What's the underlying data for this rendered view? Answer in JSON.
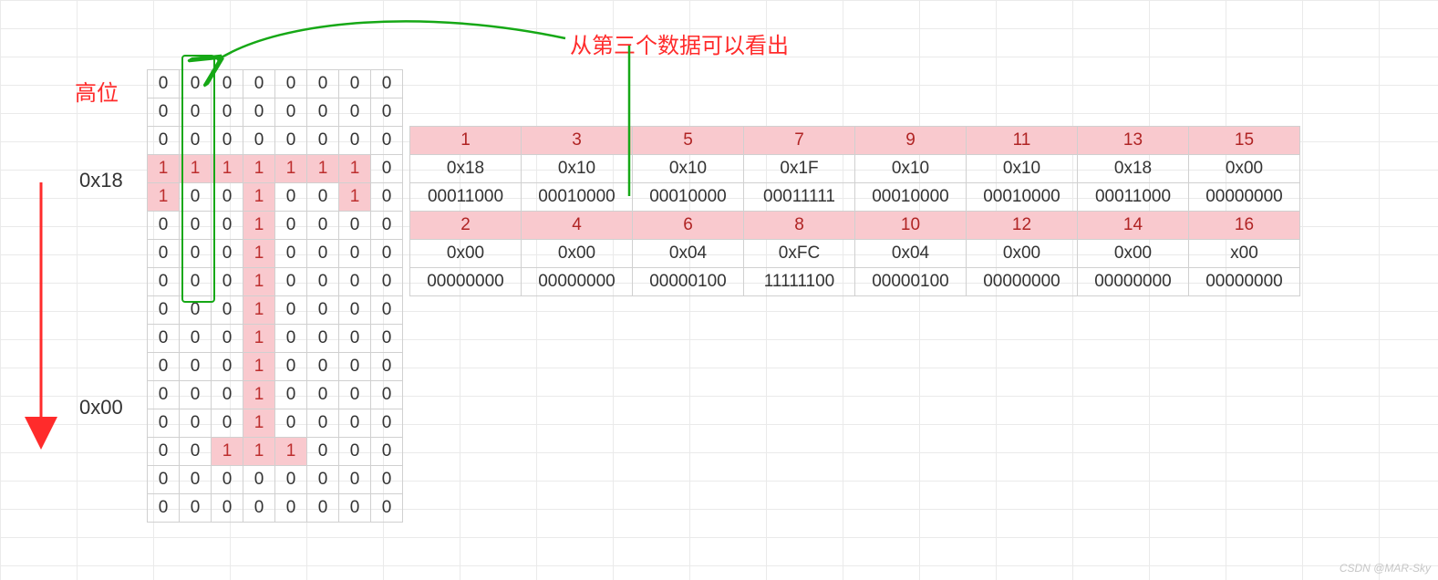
{
  "annotations": {
    "top_title": "从第三个数据可以看出",
    "high_bit": "高位",
    "label_0x18": "0x18",
    "label_0x00": "0x00"
  },
  "bit_matrix_16x8": [
    [
      "0",
      "0",
      "0",
      "0",
      "0",
      "0",
      "0",
      "0"
    ],
    [
      "0",
      "0",
      "0",
      "0",
      "0",
      "0",
      "0",
      "0"
    ],
    [
      "0",
      "0",
      "0",
      "0",
      "0",
      "0",
      "0",
      "0"
    ],
    [
      "1",
      "1",
      "1",
      "1",
      "1",
      "1",
      "1",
      "0"
    ],
    [
      "1",
      "0",
      "0",
      "1",
      "0",
      "0",
      "1",
      "0"
    ],
    [
      "0",
      "0",
      "0",
      "1",
      "0",
      "0",
      "0",
      "0"
    ],
    [
      "0",
      "0",
      "0",
      "1",
      "0",
      "0",
      "0",
      "0"
    ],
    [
      "0",
      "0",
      "0",
      "1",
      "0",
      "0",
      "0",
      "0"
    ],
    [
      "0",
      "0",
      "0",
      "1",
      "0",
      "0",
      "0",
      "0"
    ],
    [
      "0",
      "0",
      "0",
      "1",
      "0",
      "0",
      "0",
      "0"
    ],
    [
      "0",
      "0",
      "0",
      "1",
      "0",
      "0",
      "0",
      "0"
    ],
    [
      "0",
      "0",
      "0",
      "1",
      "0",
      "0",
      "0",
      "0"
    ],
    [
      "0",
      "0",
      "0",
      "1",
      "0",
      "0",
      "0",
      "0"
    ],
    [
      "0",
      "0",
      "1",
      "1",
      "1",
      "0",
      "0",
      "0"
    ],
    [
      "0",
      "0",
      "0",
      "0",
      "0",
      "0",
      "0",
      "0"
    ],
    [
      "0",
      "0",
      "0",
      "0",
      "0",
      "0",
      "0",
      "0"
    ]
  ],
  "bit_matrix_pink_mask": [
    [
      0,
      0,
      0,
      0,
      0,
      0,
      0,
      0
    ],
    [
      0,
      0,
      0,
      0,
      0,
      0,
      0,
      0
    ],
    [
      0,
      0,
      0,
      0,
      0,
      0,
      0,
      0
    ],
    [
      1,
      1,
      1,
      1,
      1,
      1,
      1,
      0
    ],
    [
      1,
      0,
      0,
      1,
      0,
      0,
      1,
      0
    ],
    [
      0,
      0,
      0,
      1,
      0,
      0,
      0,
      0
    ],
    [
      0,
      0,
      0,
      1,
      0,
      0,
      0,
      0
    ],
    [
      0,
      0,
      0,
      1,
      0,
      0,
      0,
      0
    ],
    [
      0,
      0,
      0,
      1,
      0,
      0,
      0,
      0
    ],
    [
      0,
      0,
      0,
      1,
      0,
      0,
      0,
      0
    ],
    [
      0,
      0,
      0,
      1,
      0,
      0,
      0,
      0
    ],
    [
      0,
      0,
      0,
      1,
      0,
      0,
      0,
      0
    ],
    [
      0,
      0,
      0,
      1,
      0,
      0,
      0,
      0
    ],
    [
      0,
      0,
      1,
      1,
      1,
      0,
      0,
      0
    ],
    [
      0,
      0,
      0,
      0,
      0,
      0,
      0,
      0
    ],
    [
      0,
      0,
      0,
      0,
      0,
      0,
      0,
      0
    ]
  ],
  "right": {
    "idx_odd": [
      "1",
      "3",
      "5",
      "7",
      "9",
      "11",
      "13",
      "15"
    ],
    "hex_odd": [
      "0x18",
      "0x10",
      "0x10",
      "0x1F",
      "0x10",
      "0x10",
      "0x18",
      "0x00"
    ],
    "bin_odd": [
      "00011000",
      "00010000",
      "00010000",
      "00011111",
      "00010000",
      "00010000",
      "00011000",
      "00000000"
    ],
    "idx_even": [
      "2",
      "4",
      "6",
      "8",
      "10",
      "12",
      "14",
      "16"
    ],
    "hex_even": [
      "0x00",
      "0x00",
      "0x04",
      "0xFC",
      "0x04",
      "0x00",
      "0x00",
      "x00"
    ],
    "bin_even": [
      "00000000",
      "00000000",
      "00000100",
      "11111100",
      "00000100",
      "00000000",
      "00000000",
      "00000000"
    ]
  },
  "watermark": "CSDN @MAR-Sky",
  "chart_data": {
    "type": "table",
    "description": "16x16 font bitmap for a Chinese glyph shown as a 16-row by 8-column (wide-byte) bit matrix on the left, and the corresponding 16 bytes (two rows of 8) in hex and binary on the right. Pink cells mark bits equal to 1. Green rectangle highlights column 2 (the high-bit column). Red downward arrow indicates scan direction.",
    "bytes_hex_in_column_major_order": [
      "0x18",
      "0x00",
      "0x10",
      "0x00",
      "0x10",
      "0x04",
      "0x1F",
      "0xFC",
      "0x10",
      "0x04",
      "0x10",
      "0x00",
      "0x18",
      "0x00",
      "0x00",
      "0x00"
    ]
  }
}
